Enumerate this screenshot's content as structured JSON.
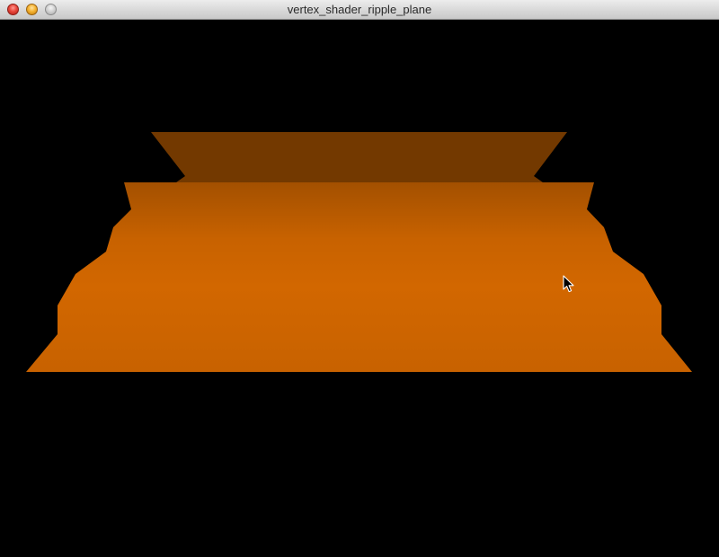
{
  "window": {
    "title": "vertex_shader_ripple_plane"
  },
  "titlebar": {
    "buttons": [
      {
        "name": "close-button",
        "icon": "close-dot-icon",
        "color": "#e8463b"
      },
      {
        "name": "minimize-button",
        "icon": "minimize-dot-icon",
        "color": "#f5b331"
      },
      {
        "name": "zoom-button",
        "icon": "zoom-dot-icon",
        "color": "#cfcfcf"
      }
    ]
  },
  "scene": {
    "background_color": "#000000",
    "plane_back_color": "#733900",
    "plane_front_top_color": "#a85300",
    "plane_front_mid_color": "#d16700",
    "plane_front_bottom_color": "#c96200",
    "cursor_icon": "arrow-cursor-icon"
  }
}
